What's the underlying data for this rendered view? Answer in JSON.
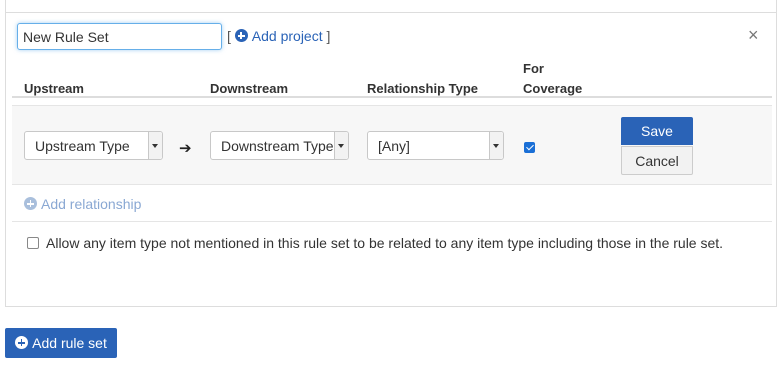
{
  "rule_set": {
    "name_value": "New Rule Set",
    "add_project_prefix": "[",
    "add_project_label": "Add project",
    "add_project_suffix": "]",
    "close_glyph": "×"
  },
  "table": {
    "headers": {
      "upstream": "Upstream",
      "downstream": "Downstream",
      "relationship_type": "Relationship Type",
      "for_coverage_line1": "For",
      "for_coverage_line2": "Coverage"
    },
    "row": {
      "upstream_value": "Upstream Type",
      "arrow_glyph": "➔",
      "downstream_value": "Downstream Type",
      "relationship_value": "[Any]",
      "for_coverage_checked": true
    }
  },
  "actions": {
    "save_label": "Save",
    "cancel_label": "Cancel",
    "add_relationship_label": "Add relationship",
    "add_rule_set_label": "Add rule set"
  },
  "allow_option": {
    "checked": false,
    "label": "Allow any item type not mentioned in this rule set to be related to any item type including those in the rule set."
  },
  "colors": {
    "primary": "#2a63b7",
    "link_muted": "#8aa8d3",
    "checkbox_blue": "#1a6fd6"
  }
}
